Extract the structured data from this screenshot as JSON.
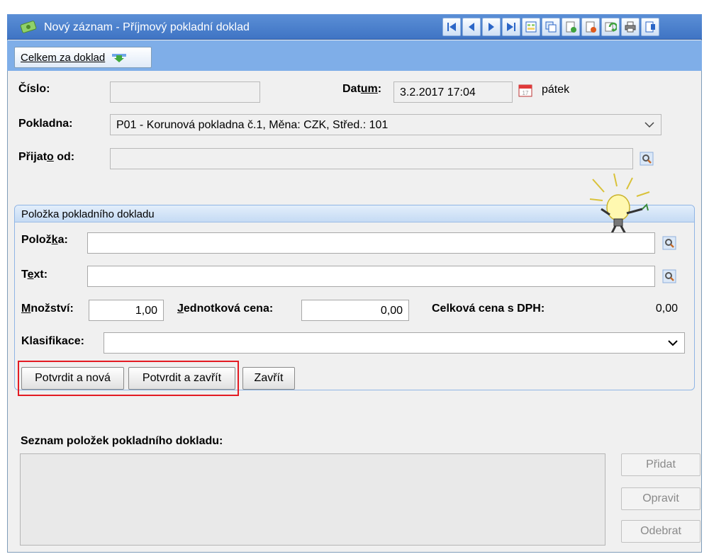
{
  "window": {
    "title": "Nový záznam - Příjmový pokladní doklad",
    "toolbar_buttons": [
      "first-record-icon",
      "previous-record-icon",
      "next-record-icon",
      "last-record-icon",
      "form-view-icon",
      "copy-record-icon",
      "new-document-icon",
      "delete-document-icon",
      "refresh-icon",
      "print-icon",
      "exit-icon"
    ]
  },
  "header_strip": {
    "celkem_label": "Celkem za doklad"
  },
  "form": {
    "cislo_label": "Číslo:",
    "cislo_value": "",
    "datum_label_pre": "Dat",
    "datum_label_u": "um",
    "datum_label_post": ":",
    "datum_value": "3.2.2017 17:04",
    "weekday": "pátek",
    "pokladna_label": "Pokladna:",
    "pokladna_value": "P01 - Korunová pokladna č.1, Měna: CZK, Střed.: 101",
    "prijato_label_pre": "Přijat",
    "prijato_label_u": "o",
    "prijato_label_post": " od:",
    "prijato_value": ""
  },
  "item_group": {
    "title": "Položka pokladního dokladu",
    "polozka_label_pre": "Polož",
    "polozka_label_u": "k",
    "polozka_label_post": "a:",
    "polozka_value": "",
    "text_label_pre": "T",
    "text_label_u": "e",
    "text_label_post": "xt:",
    "text_value": "",
    "mnozstvi_label_u": "M",
    "mnozstvi_label_post": "nožství:",
    "mnozstvi_value": "1,00",
    "jedn_cena_label_u": "J",
    "jedn_cena_label_post": "ednotková cena:",
    "jedn_cena_value": "0,00",
    "celkova_label": "Celková cena s DPH:",
    "celkova_value": "0,00",
    "klasifikace_label": "Klasifikace:",
    "klasifikace_value": "",
    "buttons": {
      "confirm_new": "Potvrdit a nová",
      "confirm_close": "Potvrdit a zavřít",
      "close": "Zavřít"
    }
  },
  "items_list": {
    "title": "Seznam položek pokladního dokladu:",
    "add": "Přidat",
    "edit": "Opravit",
    "remove": "Odebrat"
  },
  "colors": {
    "titlebar": "#3f74c4",
    "strip": "#7faee8",
    "highlight": "#e31b23"
  }
}
